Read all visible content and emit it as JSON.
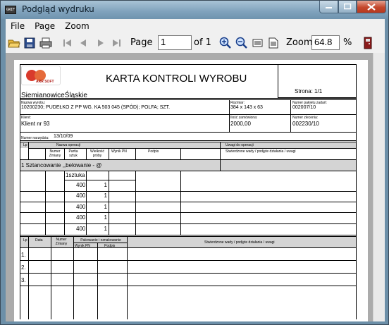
{
  "window": {
    "title": "Podgląd wydruku",
    "icon_label": "GWIF"
  },
  "menu": {
    "file": "File",
    "page": "Page",
    "zoom": "Zoom"
  },
  "toolbar": {
    "page_label": "Page",
    "page_value": "1",
    "of_label": "of 1",
    "zoom_label": "Zoom",
    "zoom_value": "64.8",
    "percent": "%"
  },
  "doc": {
    "logo_text": "ARR SOFT",
    "title": "KARTA KONTROLI WYROBU",
    "city": "SiemianowiceŚląskie",
    "page_label": "Strona: 1/1",
    "product_name_label": "Nazwa wyrobu:",
    "product_name": "10200230; PUDEŁKO Z PP WG. KA 503 045 (SPÓD); POLFA; SZT.",
    "size_label": "Rozmiar:",
    "size": "384 x 143 x 63",
    "package_label": "Numer pakietu zadań:",
    "package": "002007/10",
    "client_label": "Klient:",
    "client": "Klient nr 93",
    "ordered_qty_label": "Ilość zamówiona:",
    "ordered_qty": "2000,00",
    "plan_label": "Numer zlecenia:",
    "plan": "002230/10",
    "tool_label": "Numer narzędzia:",
    "tool": "13/10/09",
    "ops_header": {
      "lp": "Lp",
      "op_name": "Nazwa operacji",
      "remarks": "Uwagi do operacji",
      "change_no": "Numer Zmiany",
      "batch": "Partia sztuk",
      "sample_size": "Wielkość próby",
      "pn_result": "Wynik PN",
      "signature": "Podpis",
      "defects": "Stwierdzone wady / podjęte działania / uwagi"
    },
    "operation": "1  Sztancowanie ,,belowanie - @",
    "unit_label": "1sztuka",
    "rows": [
      {
        "batch": "400",
        "sample": "1"
      },
      {
        "batch": "400",
        "sample": "1"
      },
      {
        "batch": "400",
        "sample": "1"
      },
      {
        "batch": "400",
        "sample": "1"
      },
      {
        "batch": "400",
        "sample": "1"
      }
    ],
    "bottom_header": {
      "lp": "Lp",
      "date": "Data",
      "change_no": "Numer Zmiany",
      "packing": "Pakowanie i oznakowanie",
      "pn_result": "Wynik PN",
      "signature": "Podpis",
      "defects": "Stwierdzone wady / podjęte działania / uwagi"
    },
    "bottom_rows": [
      "1.",
      "2.",
      "3."
    ]
  },
  "colors": {
    "titlebar": "#7fa2bc",
    "close": "#c4472c",
    "preview_bg": "#ababab"
  },
  "icons": [
    "open-folder-icon",
    "save-icon",
    "print-icon",
    "first-page-icon",
    "prev-page-icon",
    "next-page-icon",
    "last-page-icon",
    "zoom-in-icon",
    "zoom-out-icon",
    "page-width-icon",
    "whole-page-icon",
    "exit-icon"
  ]
}
